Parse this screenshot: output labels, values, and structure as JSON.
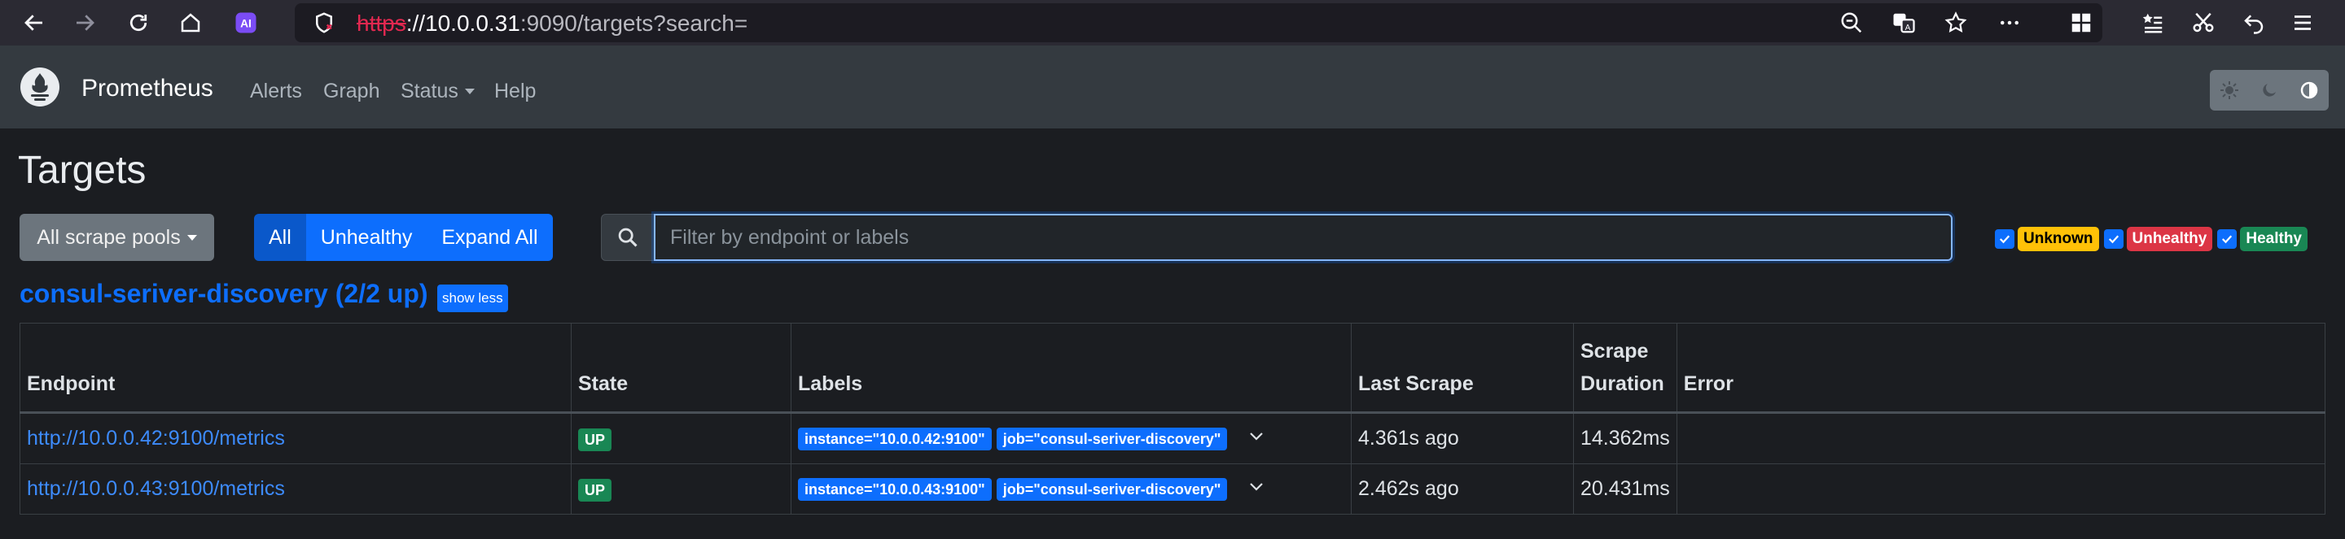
{
  "browser": {
    "url_protocol": "https",
    "url_host": "://10.0.0.31",
    "url_rest": ":9090/targets?search="
  },
  "navbar": {
    "brand": "Prometheus",
    "links": [
      "Alerts",
      "Graph",
      "Status",
      "Help"
    ]
  },
  "page": {
    "title": "Targets",
    "pool_button": "All scrape pools",
    "segments": [
      "All",
      "Unhealthy",
      "Expand All"
    ],
    "search_placeholder": "Filter by endpoint or labels",
    "filters": [
      {
        "label": "Unknown",
        "color": "#ffc107",
        "text_color": "#000000"
      },
      {
        "label": "Unhealthy",
        "color": "#dc3545",
        "text_color": "#ffffff"
      },
      {
        "label": "Healthy",
        "color": "#198754",
        "text_color": "#ffffff"
      }
    ]
  },
  "pool": {
    "title": "consul-seriver-discovery (2/2 up)",
    "toggle": "show less",
    "columns": [
      "Endpoint",
      "State",
      "Labels",
      "Last Scrape",
      "Scrape Duration",
      "Error"
    ],
    "rows": [
      {
        "endpoint": "http://10.0.0.42:9100/metrics",
        "state": "UP",
        "labels": [
          "instance=\"10.0.0.42:9100\"",
          "job=\"consul-seriver-discovery\""
        ],
        "last_scrape": "4.361s ago",
        "duration": "14.362ms",
        "error": ""
      },
      {
        "endpoint": "http://10.0.0.43:9100/metrics",
        "state": "UP",
        "labels": [
          "instance=\"10.0.0.43:9100\"",
          "job=\"consul-seriver-discovery\""
        ],
        "last_scrape": "2.462s ago",
        "duration": "20.431ms",
        "error": ""
      }
    ]
  }
}
